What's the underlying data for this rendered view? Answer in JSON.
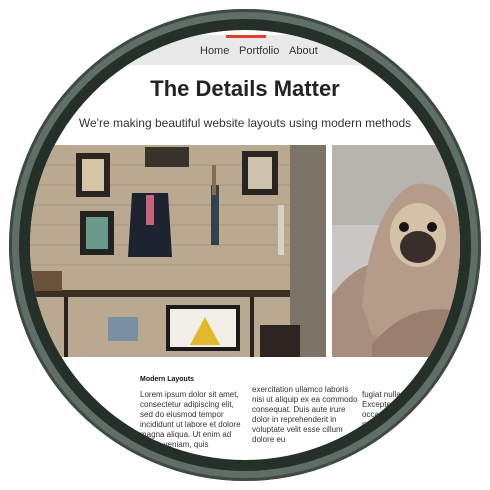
{
  "nav": {
    "items": [
      "Home",
      "Portfolio",
      "About"
    ]
  },
  "hero": {
    "title": "The Details Matter",
    "subtitle": "We're making beautiful website layouts using modern methods"
  },
  "content": {
    "heading": "Modern Layouts",
    "col1": "Lorem ipsum dolor sit amet, consectetur adipiscing elit, sed do eiusmod tempor incididunt ut labore et dolore magna aliqua. Ut enim ad minim veniam, quis",
    "col2": "exercitation ullamco laboris nisi ut aliquip ex ea commodo consequat. Duis aute irure dolor in reprehenderit in voluptate velit esse cillum dolore eu",
    "col3": "fugiat nulla pariatur. Excepteur sint occaecat cupidatat non proident"
  },
  "colors": {
    "frame": "#5f6e66",
    "frame_dark": "#243028",
    "nav_bg": "#e9e9e9",
    "nav_accent": "#e23c2e"
  }
}
